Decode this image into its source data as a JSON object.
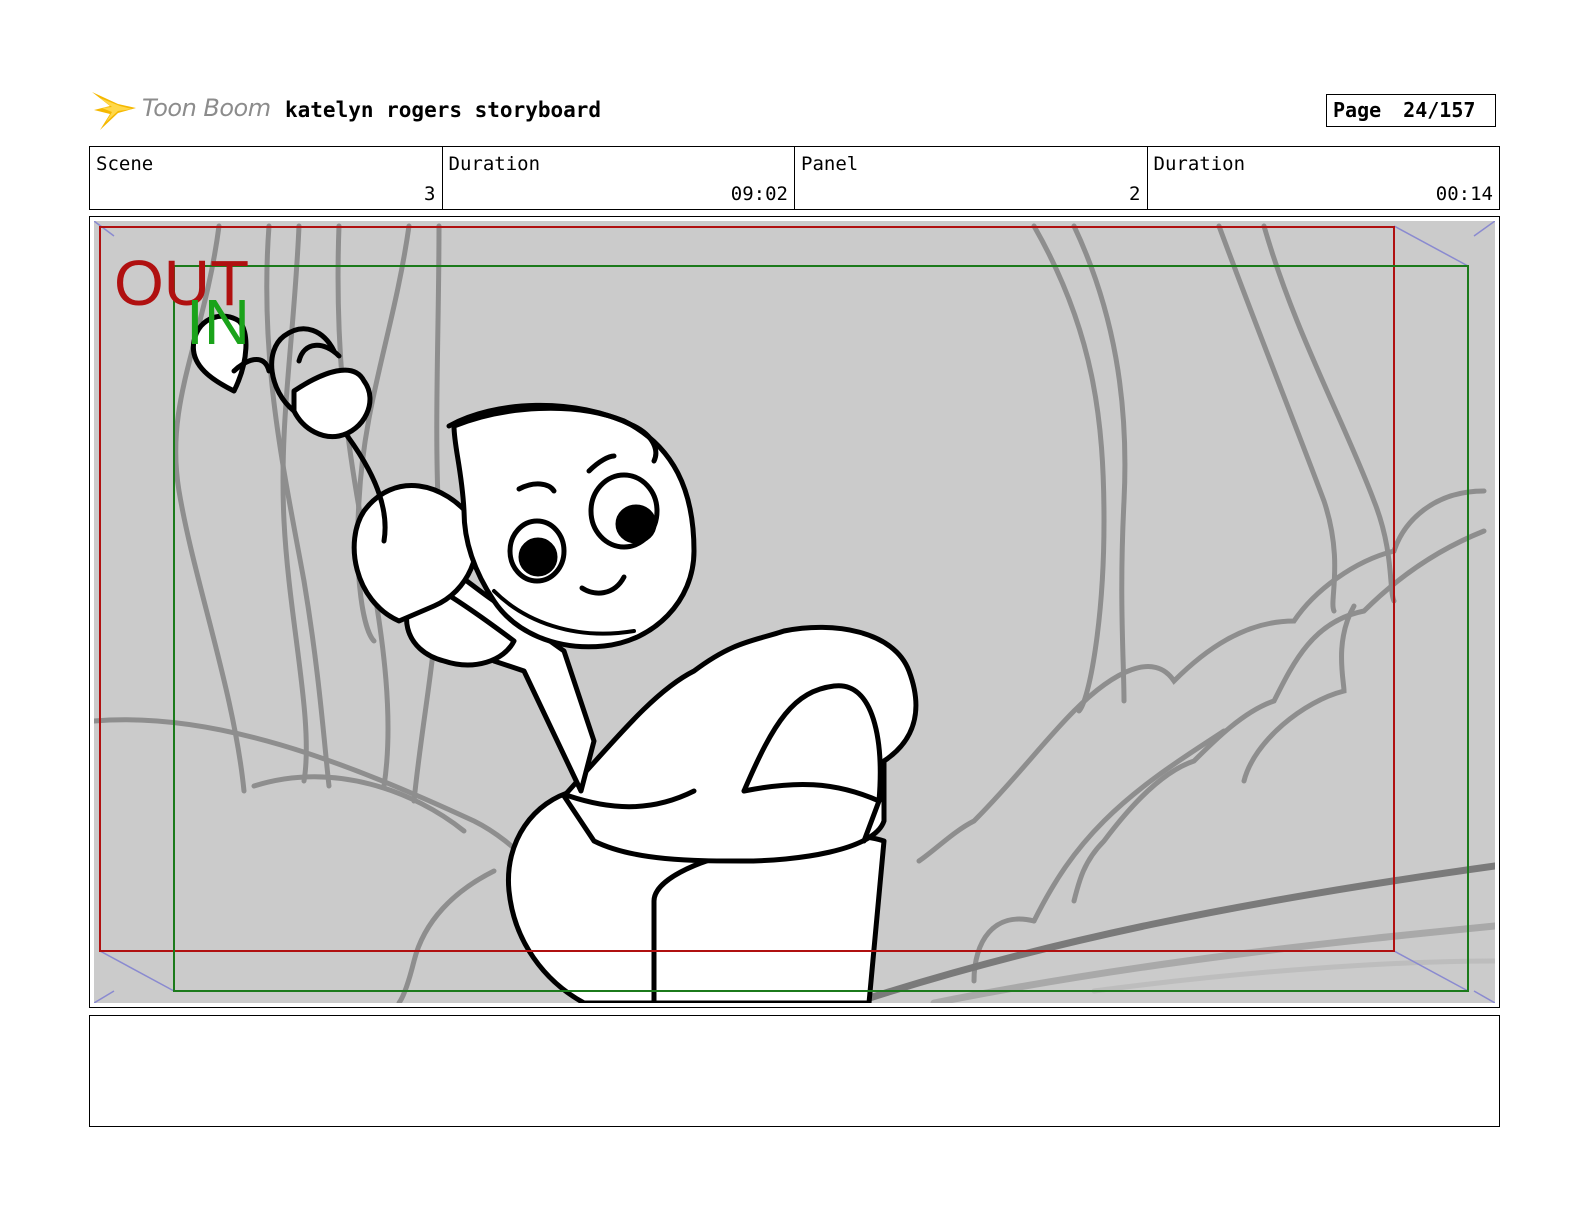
{
  "brand": {
    "name": "Toon Boom",
    "icon": "starburst-logo-icon",
    "color": "#f5b800"
  },
  "title": "katelyn rogers storyboard",
  "page": {
    "label": "Page",
    "value": "24/157"
  },
  "info": {
    "scene_label": "Scene",
    "scene_value": "3",
    "duration_label": "Duration",
    "duration_value": "09:02",
    "panel_label": "Panel",
    "panel_value": "2",
    "panel_duration_label": "Duration",
    "panel_duration_value": "00:14"
  },
  "frame_guides": {
    "out_label": "OUT",
    "out_color": "#b01010",
    "in_label": "IN",
    "in_color": "#1aa31a"
  },
  "notes": {
    "text": ""
  }
}
